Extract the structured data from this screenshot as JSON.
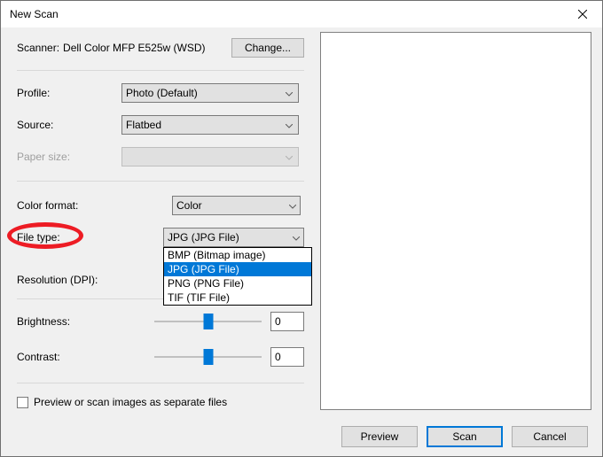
{
  "window": {
    "title": "New Scan"
  },
  "scanner": {
    "label": "Scanner:",
    "name": "Dell Color MFP E525w (WSD)",
    "change_button": "Change..."
  },
  "fields": {
    "profile": {
      "label": "Profile:",
      "value": "Photo (Default)"
    },
    "source": {
      "label": "Source:",
      "value": "Flatbed"
    },
    "paper_size": {
      "label": "Paper size:",
      "value": ""
    },
    "color_format": {
      "label": "Color format:",
      "value": "Color"
    },
    "file_type": {
      "label": "File type:",
      "value": "JPG (JPG File)",
      "options": [
        "BMP (Bitmap image)",
        "JPG (JPG File)",
        "PNG (PNG File)",
        "TIF (TIF File)"
      ],
      "selected_index": 1
    },
    "resolution": {
      "label": "Resolution (DPI):"
    },
    "brightness": {
      "label": "Brightness:",
      "value": "0"
    },
    "contrast": {
      "label": "Contrast:",
      "value": "0"
    }
  },
  "checkbox": {
    "label": "Preview or scan images as separate files"
  },
  "buttons": {
    "preview": "Preview",
    "scan": "Scan",
    "cancel": "Cancel"
  }
}
